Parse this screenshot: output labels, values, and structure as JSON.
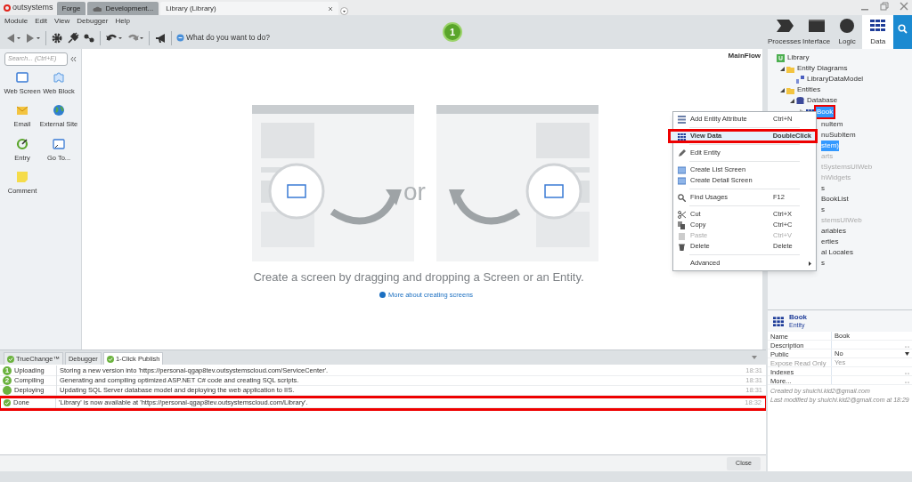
{
  "app": {
    "logo": "outsystems"
  },
  "doc_tabs": [
    {
      "label": "Forge",
      "kind": "plain",
      "selected": false
    },
    {
      "label": "Development...",
      "kind": "cloud",
      "selected": false
    },
    {
      "label": "Library (Library)",
      "kind": "plain",
      "selected": true
    }
  ],
  "menu": [
    "Module",
    "Edit",
    "View",
    "Debugger",
    "Help"
  ],
  "toolbar": {
    "search_placeholder": "What do you want to do?",
    "publish_count": "1"
  },
  "layer_tabs": [
    {
      "label": "Processes",
      "kind": "processes",
      "selected": false
    },
    {
      "label": "Interface",
      "kind": "interface",
      "selected": false
    },
    {
      "label": "Logic",
      "kind": "logic",
      "selected": false
    },
    {
      "label": "Data",
      "kind": "data",
      "selected": true
    }
  ],
  "palette": {
    "search_placeholder": "Search... (Ctrl+E)",
    "items": [
      {
        "label": "Web Screen",
        "kind": "screen"
      },
      {
        "label": "Web Block",
        "kind": "block"
      },
      {
        "label": "Email",
        "kind": "email"
      },
      {
        "label": "External Site",
        "kind": "site"
      },
      {
        "label": "Entry",
        "kind": "entry"
      },
      {
        "label": "Go To...",
        "kind": "goto"
      },
      {
        "label": "Comment",
        "kind": "comment"
      }
    ]
  },
  "canvas": {
    "flow": "MainFlow",
    "or": "or",
    "hint": "Create a screen by dragging and dropping a Screen or an Entity.",
    "link": "More about creating screens"
  },
  "tree": [
    {
      "label": "Library",
      "kind": "module",
      "children": [
        {
          "label": "Entity Diagrams",
          "kind": "folder",
          "expanded": true,
          "children": [
            {
              "label": "LibraryDataModel",
              "kind": "diagram"
            }
          ]
        },
        {
          "label": "Entities",
          "kind": "folder",
          "expanded": true,
          "children": [
            {
              "label": "Database",
              "kind": "database",
              "expanded": true,
              "children": [
                {
                  "label": "Book",
                  "kind": "entity",
                  "expanded": false,
                  "selected": true,
                  "highlighted": true
                }
              ]
            }
          ]
        }
      ]
    }
  ],
  "tree_fragments": [
    {
      "label": "nuItem",
      "selected": false,
      "disabled": false
    },
    {
      "label": "nuSubItem",
      "selected": false,
      "disabled": false
    },
    {
      "label": "stem)",
      "selected": true,
      "disabled": false
    },
    {
      "label": "arts",
      "selected": false,
      "disabled": true
    },
    {
      "label": "tSystemsUIWeb",
      "selected": false,
      "disabled": true
    },
    {
      "label": "hWidgets",
      "selected": false,
      "disabled": true
    },
    {
      "label": "s",
      "selected": false,
      "disabled": false
    },
    {
      "label": "BookList",
      "selected": false,
      "disabled": false
    },
    {
      "label": "s",
      "selected": false,
      "disabled": false
    },
    {
      "label": "stemsUIWeb",
      "selected": false,
      "disabled": true
    },
    {
      "label": "ariables",
      "selected": false,
      "disabled": false
    },
    {
      "label": "erties",
      "selected": false,
      "disabled": false
    },
    {
      "label": "al Locales",
      "selected": false,
      "disabled": false
    },
    {
      "label": "s",
      "selected": false,
      "disabled": false
    }
  ],
  "context_menu": {
    "groups": [
      [
        {
          "label": "Add Entity Attribute",
          "shortcut": "Ctrl+N",
          "kind": "attribute",
          "selected": false,
          "highlighted": false,
          "disabled": false
        }
      ],
      [
        {
          "label": "View Data",
          "shortcut": "DoubleClick",
          "kind": "grid",
          "selected": true,
          "highlighted": true,
          "disabled": false
        }
      ],
      [
        {
          "label": "Edit Entity",
          "kind": "pencil",
          "selected": false,
          "highlighted": false,
          "disabled": false
        }
      ],
      [
        {
          "label": "Create List Screen",
          "kind": "screen",
          "selected": false,
          "highlighted": false,
          "disabled": false
        },
        {
          "label": "Create Detail Screen",
          "kind": "screen",
          "selected": false,
          "highlighted": false,
          "disabled": false
        }
      ],
      [
        {
          "label": "Find Usages",
          "shortcut": "F12",
          "kind": "search",
          "selected": false,
          "highlighted": false,
          "disabled": false
        }
      ],
      [
        {
          "label": "Cut",
          "shortcut": "Ctrl+X",
          "kind": "cut",
          "selected": false,
          "highlighted": false,
          "disabled": false
        },
        {
          "label": "Copy",
          "shortcut": "Ctrl+C",
          "kind": "copy",
          "selected": false,
          "highlighted": false,
          "disabled": false
        },
        {
          "label": "Paste",
          "shortcut": "Ctrl+V",
          "kind": "paste",
          "selected": false,
          "highlighted": false,
          "disabled": true
        },
        {
          "label": "Delete",
          "shortcut": "Delete",
          "kind": "trash",
          "selected": false,
          "highlighted": false,
          "disabled": false
        }
      ],
      [
        {
          "label": "Advanced",
          "kind": "submenu",
          "selected": false,
          "highlighted": false,
          "disabled": false
        }
      ]
    ]
  },
  "properties": {
    "title": "Book",
    "subtitle": "Entity",
    "rows": [
      {
        "name": "Name",
        "value": "Book",
        "kind": "text",
        "disabled": false
      },
      {
        "name": "Description",
        "kind": "more",
        "disabled": false
      },
      {
        "name": "Public",
        "value": "No",
        "kind": "dropdown",
        "disabled": false
      },
      {
        "name": "Expose Read Only",
        "value": "Yes",
        "kind": "text",
        "disabled": true
      },
      {
        "name": "Indexes",
        "kind": "more",
        "disabled": false
      },
      {
        "name": "More...",
        "kind": "more",
        "disabled": false
      }
    ],
    "notes": [
      "Created by shuichi.kid2@gmail.com",
      "Last modified by shuichi.kid2@gmail.com at 18:29"
    ]
  },
  "output": {
    "tabs": [
      {
        "label": "TrueChange™",
        "kind": "check",
        "selected": false
      },
      {
        "label": "Debugger",
        "kind": "plain",
        "selected": false
      },
      {
        "label": "1-Click Publish",
        "kind": "check",
        "selected": true
      }
    ],
    "rows": [
      {
        "kind": "step",
        "step": "1",
        "stage": "Uploading",
        "message": "Storing a new version into 'https://personal-qgap8tev.outsystemscloud.com/ServiceCenter'.",
        "time": "18:31",
        "highlighted": false
      },
      {
        "kind": "step",
        "step": "2",
        "stage": "Compiling",
        "message": "Generating and compiling optimized ASP.NET C# code and creating SQL scripts.",
        "time": "18:31",
        "highlighted": false
      },
      {
        "kind": "step",
        "stage": "Deploying",
        "message": "Updating SQL Server database model and deploying the web application to IIS.",
        "time": "18:31",
        "highlighted": false
      },
      {
        "kind": "done",
        "stage": "Done",
        "message": "'Library' is now available at 'https://personal-qgap8tev.outsystemscloud.com/Library'.",
        "time": "18:32",
        "highlighted": true
      }
    ],
    "close_button": "Close"
  }
}
